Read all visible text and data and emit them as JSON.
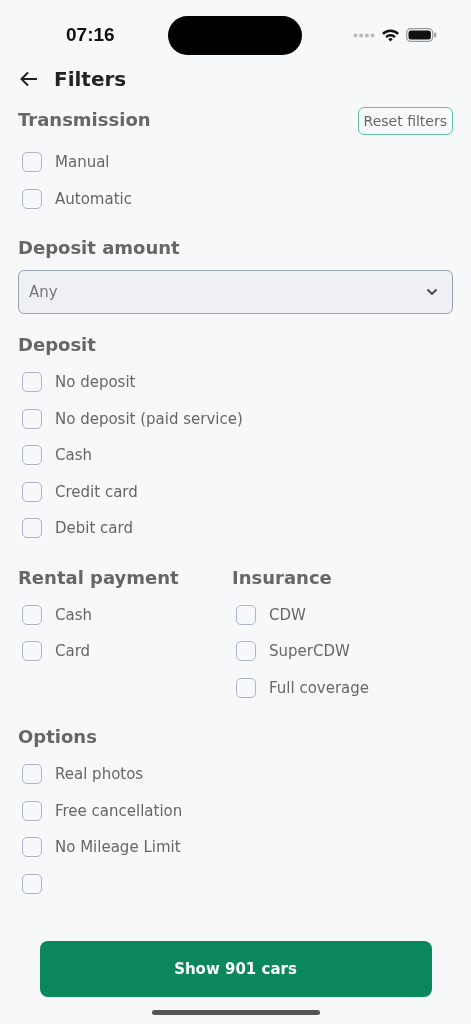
{
  "status_bar": {
    "time": "07:16"
  },
  "header": {
    "title": "Filters"
  },
  "reset_button": {
    "label": "Reset filters"
  },
  "transmission": {
    "title": "Transmission",
    "options": [
      {
        "label": "Manual",
        "checked": false
      },
      {
        "label": "Automatic",
        "checked": false
      }
    ]
  },
  "deposit_amount": {
    "title": "Deposit amount",
    "select": {
      "value": "Any"
    }
  },
  "deposit": {
    "title": "Deposit",
    "options": [
      {
        "label": "No deposit",
        "checked": false
      },
      {
        "label": "No deposit (paid service)",
        "checked": false
      },
      {
        "label": "Cash",
        "checked": false
      },
      {
        "label": "Credit card",
        "checked": false
      },
      {
        "label": "Debit card",
        "checked": false
      }
    ]
  },
  "rental_payment": {
    "title": "Rental payment",
    "options": [
      {
        "label": "Cash",
        "checked": false
      },
      {
        "label": "Card",
        "checked": false
      }
    ]
  },
  "insurance": {
    "title": "Insurance",
    "options": [
      {
        "label": "CDW",
        "checked": false
      },
      {
        "label": "SuperCDW",
        "checked": false
      },
      {
        "label": "Full coverage",
        "checked": false
      }
    ]
  },
  "options": {
    "title": "Options",
    "options": [
      {
        "label": "Real photos",
        "checked": false
      },
      {
        "label": "Free cancellation",
        "checked": false
      },
      {
        "label": "No Mileage Limit",
        "checked": false
      },
      {
        "checked": false
      }
    ]
  },
  "show_button": {
    "label": "Show 901 cars"
  }
}
